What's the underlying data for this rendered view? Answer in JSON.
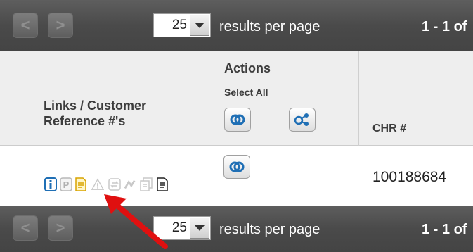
{
  "pager_top": {
    "prev_label": "<",
    "next_label": ">",
    "per_page_value": "25",
    "per_page_label": "results per page",
    "range_text": "1 - 1 of"
  },
  "pager_bottom": {
    "prev_label": "<",
    "next_label": ">",
    "per_page_value": "25",
    "per_page_label": "results per page",
    "range_text": "1 - 1 of"
  },
  "table": {
    "headers": {
      "links": "Links / Customer Reference #'s",
      "actions": "Actions",
      "select_all": "Select All",
      "chr": "CHR #"
    },
    "rows": [
      {
        "chr_number": "100188684"
      }
    ],
    "row_icons": [
      "info-icon",
      "p-icon",
      "document-note-icon",
      "warning-icon",
      "swap-icon",
      "route-icon",
      "copy-icon",
      "document-icon"
    ],
    "colors": {
      "pager_bg": "#4a4a4a",
      "header_bg": "#eeeeee",
      "info_blue": "#1f6fb5",
      "arrow_red": "#e01010"
    }
  }
}
